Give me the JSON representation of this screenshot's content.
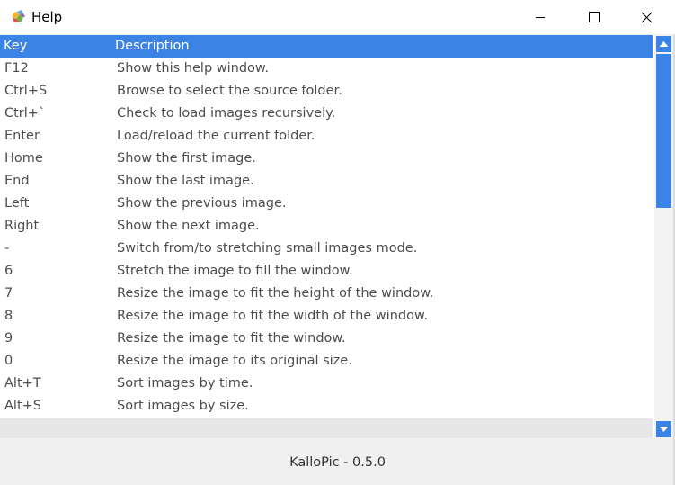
{
  "window": {
    "title": "Help"
  },
  "table": {
    "columns": {
      "key": "Key",
      "description": "Description"
    },
    "rows": [
      {
        "key": "F12",
        "description": "Show this help window."
      },
      {
        "key": "Ctrl+S",
        "description": "Browse to select the source folder."
      },
      {
        "key": "Ctrl+`",
        "description": "Check to load images recursively."
      },
      {
        "key": "Enter",
        "description": "Load/reload the current folder."
      },
      {
        "key": "Home",
        "description": "Show the first image."
      },
      {
        "key": "End",
        "description": "Show the last image."
      },
      {
        "key": "Left",
        "description": "Show the previous image."
      },
      {
        "key": "Right",
        "description": "Show the next image."
      },
      {
        "key": "-",
        "description": "Switch from/to stretching small images mode."
      },
      {
        "key": "6",
        "description": "Stretch the image to fill the window."
      },
      {
        "key": "7",
        "description": "Resize the image to fit the height of the window."
      },
      {
        "key": "8",
        "description": "Resize the image to fit the width of the window."
      },
      {
        "key": "9",
        "description": "Resize the image to fit the window."
      },
      {
        "key": "0",
        "description": "Resize the image to its original size."
      },
      {
        "key": "Alt+T",
        "description": "Sort images by time."
      },
      {
        "key": "Alt+S",
        "description": "Sort images by size."
      }
    ]
  },
  "status": {
    "text": "KalloPic - 0.5.0"
  },
  "colors": {
    "accent": "#3b84e5",
    "row_text": "#4d4d4d",
    "header_text": "#ffffff"
  },
  "icons": {
    "app": "kallopic-app-icon",
    "minimize": "minimize-icon",
    "maximize": "maximize-icon",
    "close": "close-icon",
    "scroll_up": "scroll-up-arrow-icon",
    "scroll_down": "scroll-down-arrow-icon"
  }
}
